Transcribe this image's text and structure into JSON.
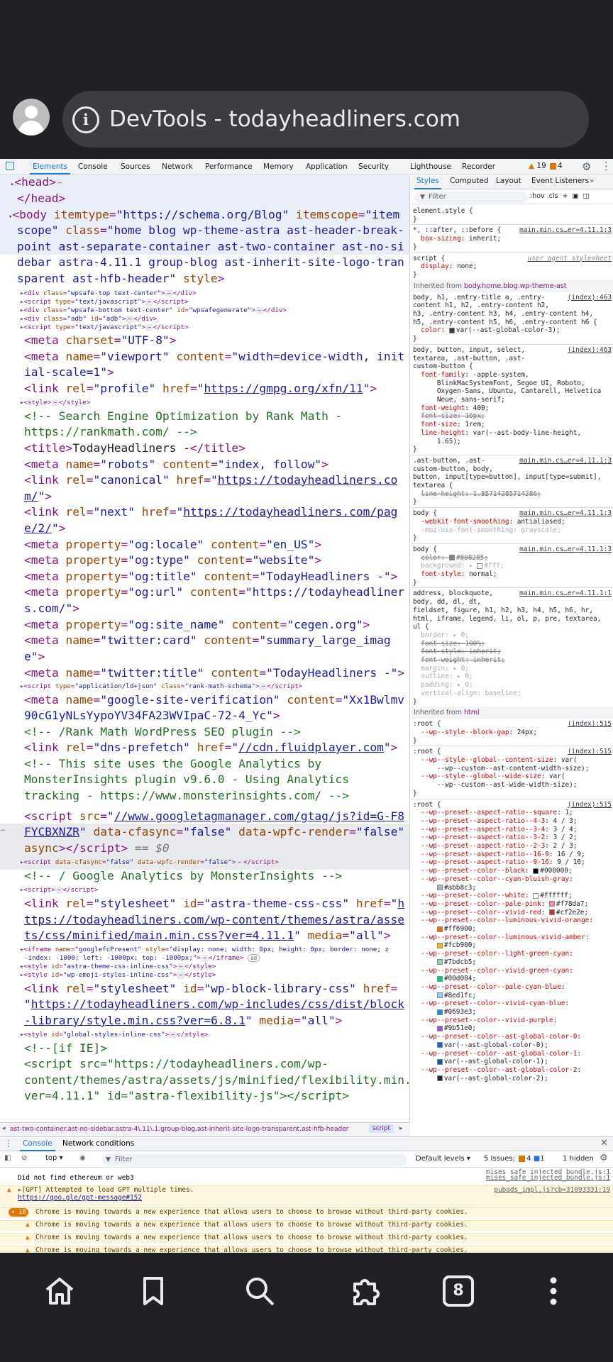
{
  "browser": {
    "title": "DevTools - todayheadliners.com",
    "tab_count": "8"
  },
  "devtools": {
    "tabs": [
      "Elements",
      "Console",
      "Sources",
      "Network",
      "Performance",
      "Memory",
      "Application",
      "Security",
      "Lighthouse",
      "Recorder"
    ],
    "warnings": "19",
    "errors": "4",
    "styles_tabs": [
      "Styles",
      "Computed",
      "Layout",
      "Event Listeners"
    ],
    "filter_placeholder": "Filter",
    "filter_tools": ":hov .cls",
    "breadcrumb": "ast-two-container.ast-no-sidebar.astra-4\\.11\\.1.group-blog.ast-inherit-site-logo-transparent.ast-hfb-header",
    "breadcrumb_selected": "script"
  },
  "drawer": {
    "tabs": [
      "Console",
      "Network conditions"
    ],
    "context": "top",
    "filter_placeholder": "Filter",
    "levels": "Default levels",
    "issues_label": "5 Issues:",
    "issues_warn": "4",
    "issues_info": "1",
    "hidden": "1 hidden",
    "cut_source": "mises_safe_injected_bundle.js:1",
    "messages": [
      {
        "text": "Did not find ethereum or web3",
        "source": "mises_safe_injected_bundle.js:1"
      },
      {
        "text": "[GPT] Attempted to load GPT multiple times.",
        "link": "https://goo.gle/gpt-message#152",
        "source": "pubads_impl.js?cb=31093331:19"
      },
      {
        "count": "18",
        "text": "Chrome is moving towards a new experience that allows users to choose to browse without third-party cookies."
      },
      {
        "text": "Chrome is moving towards a new experience that allows users to choose to browse without third-party cookies."
      },
      {
        "text": "Chrome is moving towards a new experience that allows users to choose to browse without third-party cookies."
      },
      {
        "text": "Chrome is moving towards a new experience that allows users to choose to browse without third-party cookies."
      }
    ]
  },
  "colors": {
    "accent": "#1a73e8",
    "tag": "#881280",
    "attr_name": "#994500",
    "attr_value": "#1a1aa6",
    "comment": "#236e25",
    "warning": "#e37400"
  },
  "icons": [
    "inspect-icon",
    "device-toolbar-icon",
    "gear-icon",
    "kebab-icon",
    "home-icon",
    "bookmark-icon",
    "search-icon",
    "extensions-icon",
    "tabs-icon",
    "more-icon"
  ]
}
